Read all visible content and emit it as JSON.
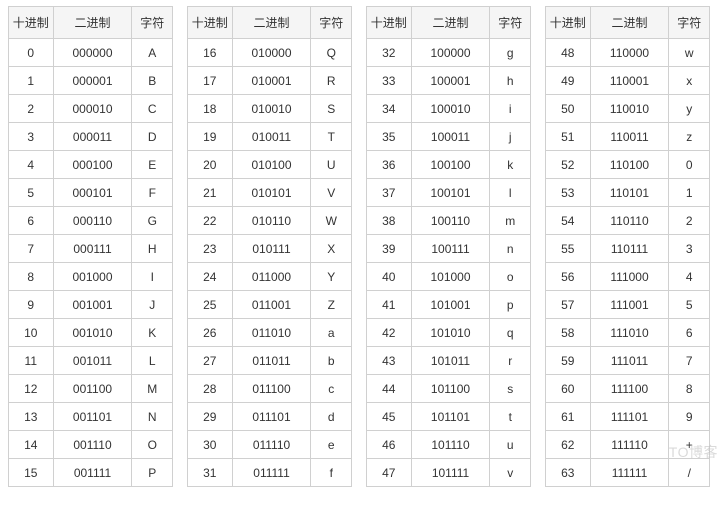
{
  "headers": {
    "dec": "十进制",
    "bin": "二进制",
    "chr": "字符"
  },
  "watermark": "TO博客",
  "chart_data": {
    "type": "table",
    "title": "Base64 index table (decimal / binary / character)",
    "columns": [
      "十进制",
      "二进制",
      "字符"
    ],
    "rows": [
      {
        "dec": 0,
        "bin": "000000",
        "chr": "A"
      },
      {
        "dec": 1,
        "bin": "000001",
        "chr": "B"
      },
      {
        "dec": 2,
        "bin": "000010",
        "chr": "C"
      },
      {
        "dec": 3,
        "bin": "000011",
        "chr": "D"
      },
      {
        "dec": 4,
        "bin": "000100",
        "chr": "E"
      },
      {
        "dec": 5,
        "bin": "000101",
        "chr": "F"
      },
      {
        "dec": 6,
        "bin": "000110",
        "chr": "G"
      },
      {
        "dec": 7,
        "bin": "000111",
        "chr": "H"
      },
      {
        "dec": 8,
        "bin": "001000",
        "chr": "I"
      },
      {
        "dec": 9,
        "bin": "001001",
        "chr": "J"
      },
      {
        "dec": 10,
        "bin": "001010",
        "chr": "K"
      },
      {
        "dec": 11,
        "bin": "001011",
        "chr": "L"
      },
      {
        "dec": 12,
        "bin": "001100",
        "chr": "M"
      },
      {
        "dec": 13,
        "bin": "001101",
        "chr": "N"
      },
      {
        "dec": 14,
        "bin": "001110",
        "chr": "O"
      },
      {
        "dec": 15,
        "bin": "001111",
        "chr": "P"
      },
      {
        "dec": 16,
        "bin": "010000",
        "chr": "Q"
      },
      {
        "dec": 17,
        "bin": "010001",
        "chr": "R"
      },
      {
        "dec": 18,
        "bin": "010010",
        "chr": "S"
      },
      {
        "dec": 19,
        "bin": "010011",
        "chr": "T"
      },
      {
        "dec": 20,
        "bin": "010100",
        "chr": "U"
      },
      {
        "dec": 21,
        "bin": "010101",
        "chr": "V"
      },
      {
        "dec": 22,
        "bin": "010110",
        "chr": "W"
      },
      {
        "dec": 23,
        "bin": "010111",
        "chr": "X"
      },
      {
        "dec": 24,
        "bin": "011000",
        "chr": "Y"
      },
      {
        "dec": 25,
        "bin": "011001",
        "chr": "Z"
      },
      {
        "dec": 26,
        "bin": "011010",
        "chr": "a"
      },
      {
        "dec": 27,
        "bin": "011011",
        "chr": "b"
      },
      {
        "dec": 28,
        "bin": "011100",
        "chr": "c"
      },
      {
        "dec": 29,
        "bin": "011101",
        "chr": "d"
      },
      {
        "dec": 30,
        "bin": "011110",
        "chr": "e"
      },
      {
        "dec": 31,
        "bin": "011111",
        "chr": "f"
      },
      {
        "dec": 32,
        "bin": "100000",
        "chr": "g"
      },
      {
        "dec": 33,
        "bin": "100001",
        "chr": "h"
      },
      {
        "dec": 34,
        "bin": "100010",
        "chr": "i"
      },
      {
        "dec": 35,
        "bin": "100011",
        "chr": "j"
      },
      {
        "dec": 36,
        "bin": "100100",
        "chr": "k"
      },
      {
        "dec": 37,
        "bin": "100101",
        "chr": "l"
      },
      {
        "dec": 38,
        "bin": "100110",
        "chr": "m"
      },
      {
        "dec": 39,
        "bin": "100111",
        "chr": "n"
      },
      {
        "dec": 40,
        "bin": "101000",
        "chr": "o"
      },
      {
        "dec": 41,
        "bin": "101001",
        "chr": "p"
      },
      {
        "dec": 42,
        "bin": "101010",
        "chr": "q"
      },
      {
        "dec": 43,
        "bin": "101011",
        "chr": "r"
      },
      {
        "dec": 44,
        "bin": "101100",
        "chr": "s"
      },
      {
        "dec": 45,
        "bin": "101101",
        "chr": "t"
      },
      {
        "dec": 46,
        "bin": "101110",
        "chr": "u"
      },
      {
        "dec": 47,
        "bin": "101111",
        "chr": "v"
      },
      {
        "dec": 48,
        "bin": "110000",
        "chr": "w"
      },
      {
        "dec": 49,
        "bin": "110001",
        "chr": "x"
      },
      {
        "dec": 50,
        "bin": "110010",
        "chr": "y"
      },
      {
        "dec": 51,
        "bin": "110011",
        "chr": "z"
      },
      {
        "dec": 52,
        "bin": "110100",
        "chr": "0"
      },
      {
        "dec": 53,
        "bin": "110101",
        "chr": "1"
      },
      {
        "dec": 54,
        "bin": "110110",
        "chr": "2"
      },
      {
        "dec": 55,
        "bin": "110111",
        "chr": "3"
      },
      {
        "dec": 56,
        "bin": "111000",
        "chr": "4"
      },
      {
        "dec": 57,
        "bin": "111001",
        "chr": "5"
      },
      {
        "dec": 58,
        "bin": "111010",
        "chr": "6"
      },
      {
        "dec": 59,
        "bin": "111011",
        "chr": "7"
      },
      {
        "dec": 60,
        "bin": "111100",
        "chr": "8"
      },
      {
        "dec": 61,
        "bin": "111101",
        "chr": "9"
      },
      {
        "dec": 62,
        "bin": "111110",
        "chr": "+"
      },
      {
        "dec": 63,
        "bin": "111111",
        "chr": "/"
      }
    ]
  }
}
